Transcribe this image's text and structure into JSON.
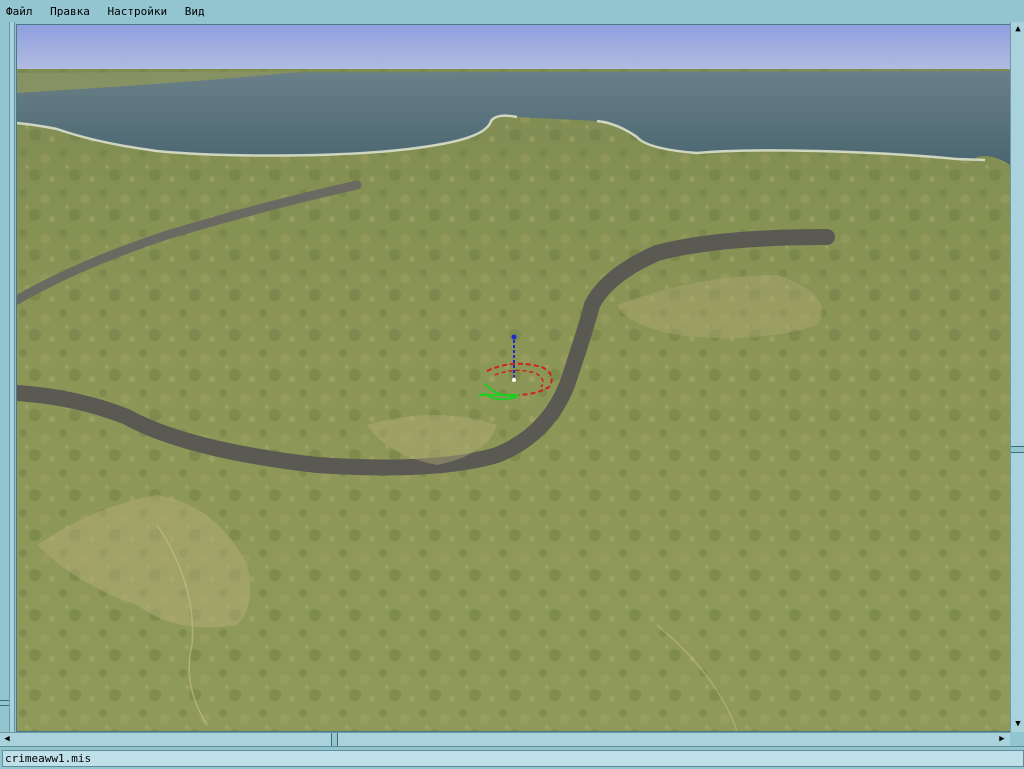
{
  "menu": {
    "items": [
      "Файл",
      "Правка",
      "Настройки",
      "Вид"
    ]
  },
  "status": {
    "filename": "crimeaww1.mis"
  },
  "scrollbars": {
    "vertical": {
      "up_icon": "arrow-up-icon",
      "down_icon": "arrow-down-icon"
    },
    "horizontal": {
      "left_icon": "arrow-left-icon",
      "right_icon": "arrow-right-icon"
    }
  },
  "colors": {
    "chrome": "#93c5d0",
    "sky": "#9aa8dd",
    "sea": "#4f6a74",
    "land": "#8a9650",
    "river": "#5a5a52"
  }
}
